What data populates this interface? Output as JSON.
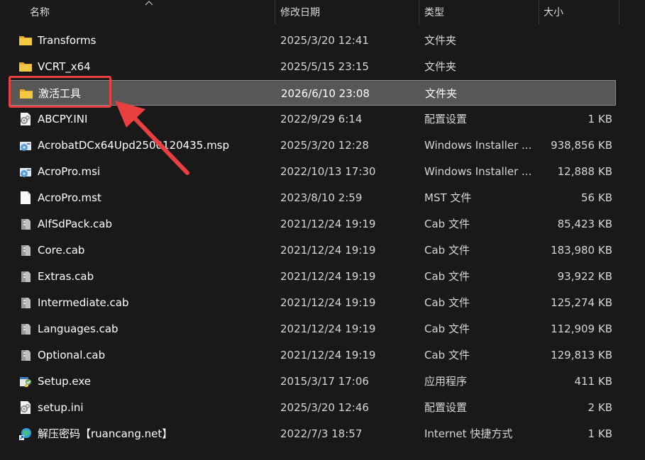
{
  "header": {
    "name_label": "名称",
    "date_label": "修改日期",
    "type_label": "类型",
    "size_label": "大小"
  },
  "files": [
    {
      "name": "Transforms",
      "date": "2025/3/20 12:41",
      "type": "文件夹",
      "size": "",
      "icon": "folder-icon"
    },
    {
      "name": "VCRT_x64",
      "date": "2025/5/15 23:15",
      "type": "文件夹",
      "size": "",
      "icon": "folder-icon"
    },
    {
      "name": "激活工具",
      "date": "2026/6/10 23:08",
      "type": "文件夹",
      "size": "",
      "icon": "folder-icon",
      "selected": true
    },
    {
      "name": "ABCPY.INI",
      "date": "2022/9/29 6:14",
      "type": "配置设置",
      "size": "1 KB",
      "icon": "config-file-icon"
    },
    {
      "name": "AcrobatDCx64Upd2500120435.msp",
      "date": "2025/3/20 12:28",
      "type": "Windows Installer ...",
      "size": "938,856 KB",
      "icon": "installer-package-icon"
    },
    {
      "name": "AcroPro.msi",
      "date": "2022/10/13 17:30",
      "type": "Windows Installer ...",
      "size": "12,888 KB",
      "icon": "installer-package-icon"
    },
    {
      "name": "AcroPro.mst",
      "date": "2023/8/10 2:59",
      "type": "MST 文件",
      "size": "56 KB",
      "icon": "blank-file-icon"
    },
    {
      "name": "AlfSdPack.cab",
      "date": "2021/12/24 19:19",
      "type": "Cab 文件",
      "size": "85,423 KB",
      "icon": "cabinet-file-icon"
    },
    {
      "name": "Core.cab",
      "date": "2021/12/24 19:19",
      "type": "Cab 文件",
      "size": "183,980 KB",
      "icon": "cabinet-file-icon"
    },
    {
      "name": "Extras.cab",
      "date": "2021/12/24 19:19",
      "type": "Cab 文件",
      "size": "93,922 KB",
      "icon": "cabinet-file-icon"
    },
    {
      "name": "Intermediate.cab",
      "date": "2021/12/24 19:19",
      "type": "Cab 文件",
      "size": "125,274 KB",
      "icon": "cabinet-file-icon"
    },
    {
      "name": "Languages.cab",
      "date": "2021/12/24 19:19",
      "type": "Cab 文件",
      "size": "112,909 KB",
      "icon": "cabinet-file-icon"
    },
    {
      "name": "Optional.cab",
      "date": "2021/12/24 19:19",
      "type": "Cab 文件",
      "size": "129,813 KB",
      "icon": "cabinet-file-icon"
    },
    {
      "name": "Setup.exe",
      "date": "2015/3/17 17:06",
      "type": "应用程序",
      "size": "411 KB",
      "icon": "setup-exe-icon"
    },
    {
      "name": "setup.ini",
      "date": "2025/3/20 12:46",
      "type": "配置设置",
      "size": "2 KB",
      "icon": "config-file-icon"
    },
    {
      "name": "解压密码【ruancang.net】",
      "date": "2022/7/3 18:57",
      "type": "Internet 快捷方式",
      "size": "1 KB",
      "icon": "internet-shortcut-icon"
    }
  ],
  "colors": {
    "background": "#191919",
    "selected_row": "#575757",
    "annotation": "#e84040",
    "folder": "#f3c13a"
  }
}
